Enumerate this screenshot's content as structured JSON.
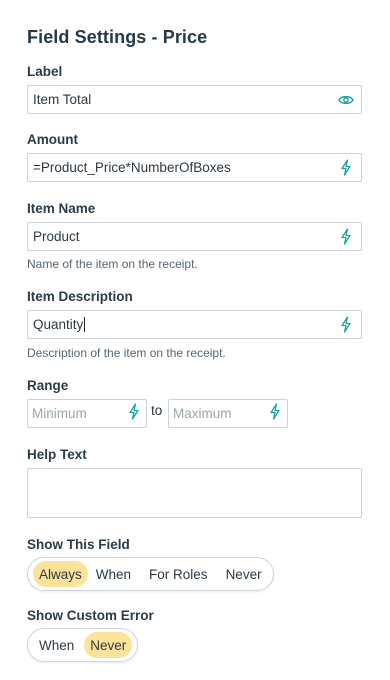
{
  "panel": {
    "title": "Field Settings - Price"
  },
  "label_field": {
    "label": "Label",
    "value": "Item Total",
    "icon": "eye-icon"
  },
  "amount_field": {
    "label": "Amount",
    "value": "=Product_Price*NumberOfBoxes",
    "icon": "lightning-icon"
  },
  "item_name_field": {
    "label": "Item Name",
    "value": "Product",
    "hint": "Name of the item on the receipt.",
    "icon": "lightning-icon"
  },
  "item_description_field": {
    "label": "Item Description",
    "value": "Quantity",
    "hint": "Description of the item on the receipt.",
    "icon": "lightning-icon"
  },
  "range": {
    "label": "Range",
    "min_placeholder": "Minimum",
    "max_placeholder": "Maximum",
    "separator": "to"
  },
  "help_text": {
    "label": "Help Text",
    "value": ""
  },
  "show_field": {
    "label": "Show This Field",
    "options": [
      "Always",
      "When",
      "For Roles",
      "Never"
    ],
    "selected": "Always"
  },
  "custom_error": {
    "label": "Show Custom Error",
    "options": [
      "When",
      "Never"
    ],
    "selected": "Never"
  },
  "colors": {
    "accent": "#1aa39a",
    "selected_pill": "#fde39a",
    "border": "#cbd3d8",
    "title": "#253a48"
  }
}
